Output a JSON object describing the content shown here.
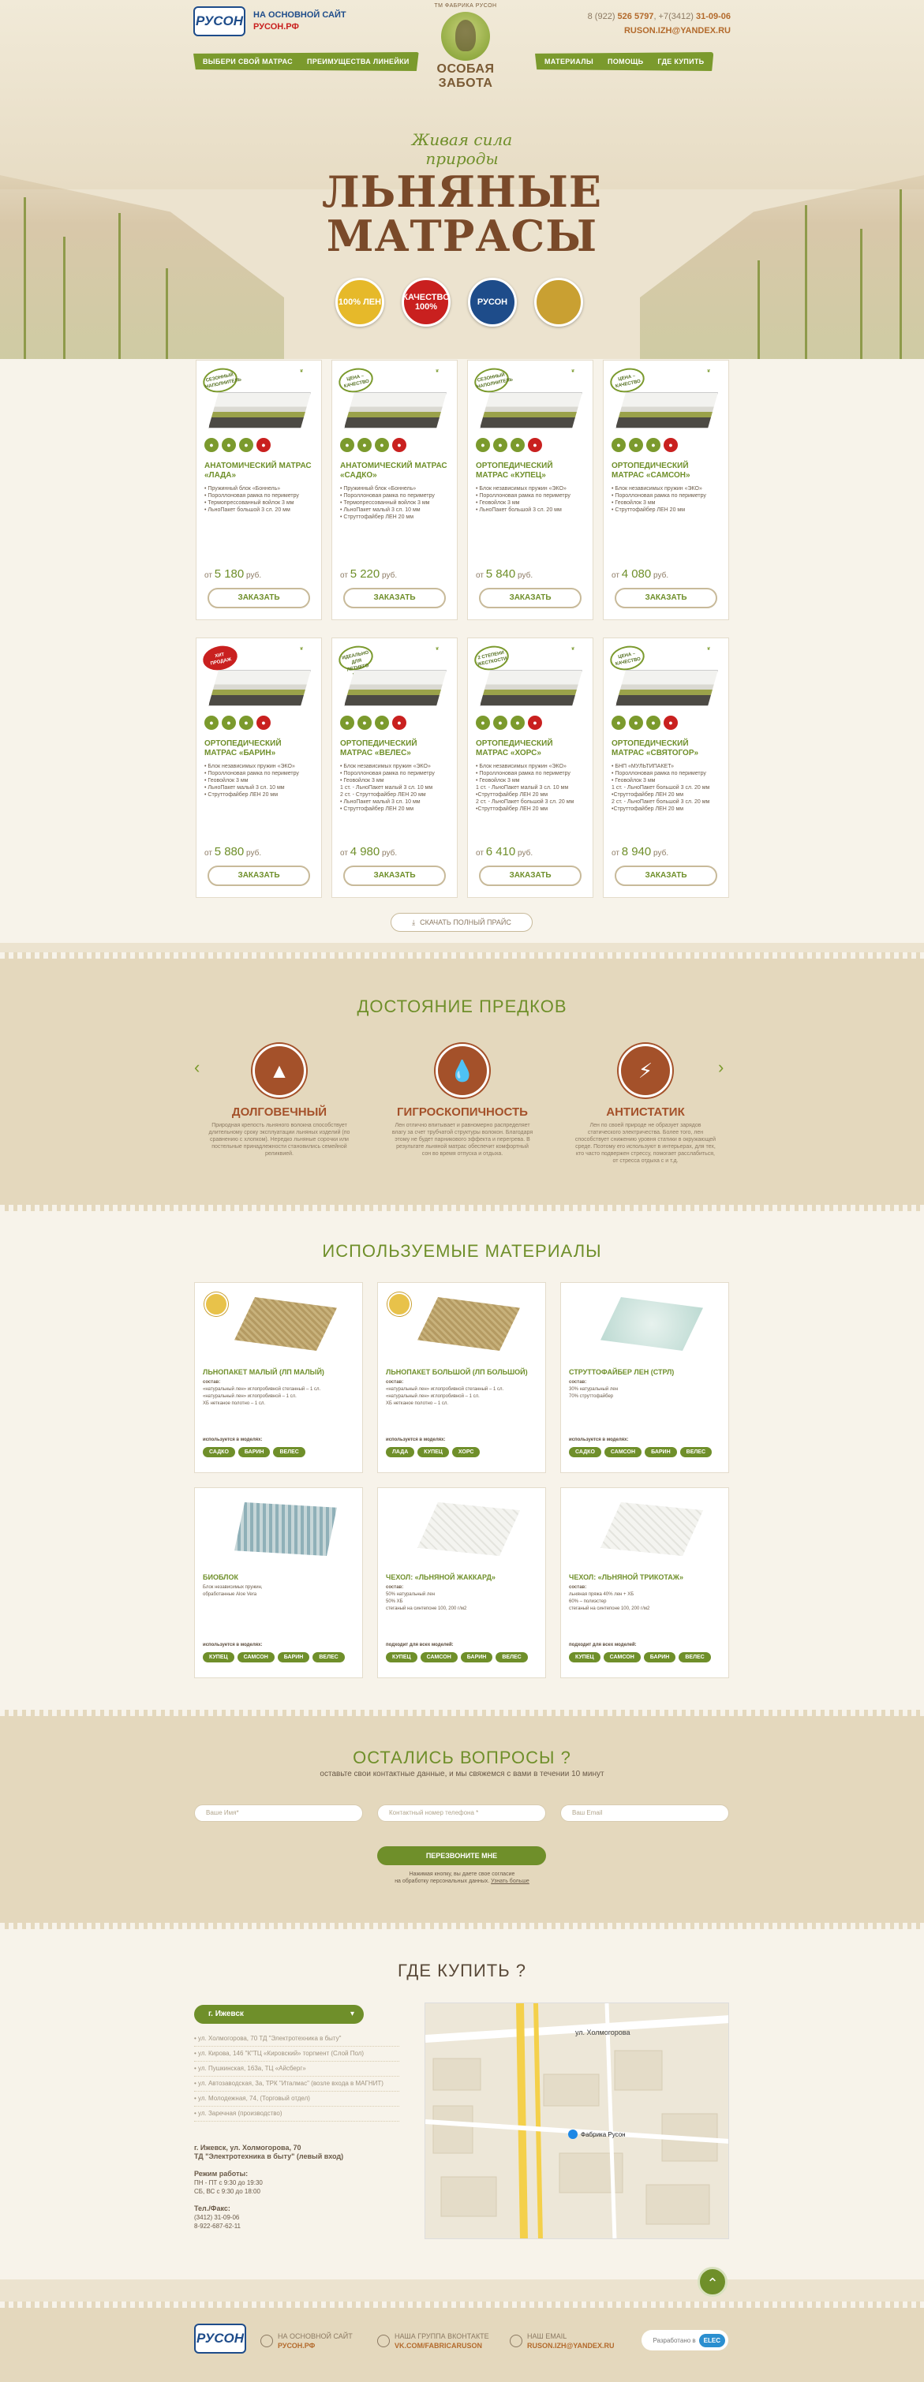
{
  "header": {
    "main_site_label": "НА ОСНОВНОЙ САЙТ",
    "main_site_url": "РУСОН.РФ",
    "logo_text": "РУСОН",
    "brand_arc": "ТМ ФАБРИКА РУСОН",
    "brand_name": "ОСОБАЯ ЗАБОТА",
    "phones_prefix": "8 (922)",
    "phone1": "526 5797",
    "phone_sep": ", +7(3412)",
    "phone2": "31-09-06",
    "email": "RUSON.IZH@YANDEX.RU",
    "nav_left": [
      "ВЫБЕРИ СВОЙ МАТРАС",
      "ПРЕИМУЩЕСТВА ЛИНЕЙКИ"
    ],
    "nav_right": [
      "МАТЕРИАЛЫ",
      "ПОМОЩЬ",
      "ГДЕ КУПИТЬ"
    ]
  },
  "hero": {
    "slogan_line1": "Живая сила",
    "slogan_line2": "природы",
    "title_line1": "ЛЬНЯНЫЕ",
    "title_line2": "МАТРАСЫ",
    "badges": [
      {
        "text": "100% ЛЕН",
        "color": "#e6b92a"
      },
      {
        "text": "КАЧЕСТВО 100%",
        "color": "#c9201f"
      },
      {
        "text": "РУСОН",
        "color": "#1e4c8a"
      },
      {
        "text": "",
        "color": "#c9a032"
      }
    ]
  },
  "products": [
    {
      "tag": "СЕЗОННЫЙ НАПОЛНИТЕЛЬ",
      "tag_red": false,
      "name": "АНАТОМИЧЕСКИЙ МАТРАС «ЛАДА»",
      "specs": [
        "• Пружинный блок «Боннель»",
        "• Пороллоновая рамка по периметру",
        "• Термопрессованный войлок 3 мм",
        "• ЛьноПакет большой 3 сл. 20 мм"
      ],
      "price": "5 180",
      "currency": "руб.",
      "price_prefix": "от",
      "order": "ЗАКАЗАТЬ"
    },
    {
      "tag": "ЦЕНА – КАЧЕСТВО",
      "tag_red": false,
      "name": "АНАТОМИЧЕСКИЙ МАТРАС «САДКО»",
      "specs": [
        "• Пружинный блок «Боннель»",
        "• Пороллоновая рамка по периметру",
        "• Термопрессованный войлок 3 мм",
        "• ЛьноПакет малый 3 сл. 10 мм",
        "• Струттофайбер ЛЕН 20 мм"
      ],
      "price": "5 220",
      "currency": "руб.",
      "price_prefix": "от",
      "order": "ЗАКАЗАТЬ"
    },
    {
      "tag": "СЕЗОННЫЙ НАПОЛНИТЕЛЬ",
      "tag_red": false,
      "name": "ОРТОПЕДИЧЕСКИЙ МАТРАС «КУПЕЦ»",
      "specs": [
        "• Блок независимых пружин «ЭКО»",
        "• Пороллоновая рамка по периметру",
        "• Геовойлок 3 мм",
        "• ЛьноПакет большой 3 сл. 20 мм"
      ],
      "price": "5 840",
      "currency": "руб.",
      "price_prefix": "от",
      "order": "ЗАКАЗАТЬ"
    },
    {
      "tag": "ЦЕНА – КАЧЕСТВО",
      "tag_red": false,
      "name": "ОРТОПЕДИЧЕСКИЙ МАТРАС «САМСОН»",
      "specs": [
        "• Блок независимых пружин «ЭКО»",
        "• Пороллоновая рамка по периметру",
        "• Геовойлок 3 мм",
        "• Струттофайбер ЛЕН 20 мм"
      ],
      "price": "4 080",
      "currency": "руб.",
      "price_prefix": "от",
      "order": "ЗАКАЗАТЬ"
    },
    {
      "tag": "ХИТ ПРОДАЖ",
      "tag_red": true,
      "name": "ОРТОПЕДИЧЕСКИЙ МАТРАС «БАРИН»",
      "specs": [
        "• Блок независимых пружин «ЭКО»",
        "• Пороллоновая рамка по периметру",
        "• Геовойлок 3 мм",
        "• ЛьноПакет малый 3 сл. 10 мм",
        "• Струттофайбер ЛЕН 20 мм"
      ],
      "price": "5 880",
      "currency": "руб.",
      "price_prefix": "от",
      "order": "ЗАКАЗАТЬ"
    },
    {
      "tag": "ИДЕАЛЬНО ДЛЯ ЛЕТНЕГО ВЕСА",
      "tag_red": false,
      "name": "ОРТОПЕДИЧЕСКИЙ МАТРАС «ВЕЛЕС»",
      "specs": [
        "• Блок независимых пружин «ЭКО»",
        "• Пороллоновая рамка по периметру",
        "• Геовойлок 3 мм",
        "1 ст. - ЛьноПакет малый 3 сл. 10 мм",
        "2 ст. - Струттофайбер ЛЕН 20 мм",
        "• ЛьноПакет малый 3 сл. 10 мм",
        "• Струттофайбер ЛЕН 20 мм"
      ],
      "price": "4 980",
      "currency": "руб.",
      "price_prefix": "от",
      "order": "ЗАКАЗАТЬ"
    },
    {
      "tag": "2 СТЕПЕНИ ЖЕСТКОСТИ",
      "tag_red": false,
      "name": "ОРТОПЕДИЧЕСКИЙ МАТРАС «ХОРС»",
      "specs": [
        "• Блок независимых пружин «ЭКО»",
        "• Пороллоновая рамка по периметру",
        "• Геовойлок 3 мм",
        "1 ст. - ЛьноПакет малый 3 сл. 10 мм",
        "  •Струттофайбер ЛЕН 20 мм",
        "2 ст. - ЛьноПакет большой 3 сл. 20 мм",
        "  •Струттофайбер ЛЕН 20 мм"
      ],
      "price": "6 410",
      "currency": "руб.",
      "price_prefix": "от",
      "order": "ЗАКАЗАТЬ"
    },
    {
      "tag": "ЦЕНА – КАЧЕСТВО",
      "tag_red": false,
      "name": "ОРТОПЕДИЧЕСКИЙ МАТРАС «СВЯТОГОР»",
      "specs": [
        "• БНП «МУЛЬТИПАКЕТ»",
        "• Пороллоновая рамка по периметру",
        "• Геовойлок 3 мм",
        "1 ст. - ЛьноПакет большой 3 сл. 20 мм",
        "  •Струттофайбер ЛЕН 20 мм",
        "2 ст. - ЛьноПакет большой 3 сл. 20 мм",
        "  •Струттофайбер ЛЕН 20 мм"
      ],
      "price": "8 940",
      "currency": "руб.",
      "price_prefix": "от",
      "order": "ЗАКАЗАТЬ"
    }
  ],
  "download_label": "СКАЧАТЬ ПОЛНЫЙ ПРАЙС",
  "legacy": {
    "title": "ДОСТОЯНИЕ ПРЕДКОВ",
    "features": [
      {
        "title": "ДОЛГОВЕЧНЫЙ",
        "text": "Природная крепость льняного волокна способствует длительному сроку эксплуатации льняных изделий (по сравнению с хлопком). Нередко льняные сорочки или постельные принадлежности становились семейной реликвией."
      },
      {
        "title": "ГИГРОСКОПИЧНОСТЬ",
        "text": "Лен отлично впитывает и равномерно распределяет влагу за счет трубчатой структуры волокон. Благодаря этому не будет парникового эффекта и перегрева. В результате льняной матрас обеспечит комфортный сон во время отпуска и отдыха."
      },
      {
        "title": "АНТИСТАТИК",
        "text": "Лен по своей природе не образует зарядов статического электричества. Более того, лен способствует снижению уровня статики в окружающей среде. Поэтому его используют в интерьерах, для тех, кто часто подвержен стрессу, помогает расслабиться, от стресса отдыха с и т.д."
      }
    ]
  },
  "materials": {
    "title": "ИСПОЛЬЗУЕМЫЕ МАТЕРИАЛЫ",
    "items": [
      {
        "name": "ЛЬНОПАКЕТ МАЛЫЙ (ЛП МАЛЫЙ)",
        "comp_label": "состав:",
        "comp": [
          "«натуральный лен» иглопробивной стеганный – 1 сл.",
          "«натуральный лен» иглопробивной – 1 сл.",
          "ХБ нетканое полотно – 1 сл."
        ],
        "used_label": "используется в моделях:",
        "models": [
          "САДКО",
          "БАРИН",
          "ВЕЛЕС"
        ],
        "seal": true,
        "img": "linen"
      },
      {
        "name": "ЛЬНОПАКЕТ БОЛЬШОЙ (ЛП БОЛЬШОЙ)",
        "comp_label": "состав:",
        "comp": [
          "«натуральный лен» иглопробивной стеганный – 1 сл.",
          "«натуральный лен» иглопробивной – 1 сл.",
          "ХБ нетканое полотно – 1 сл."
        ],
        "used_label": "используется в моделях:",
        "models": [
          "ЛАДА",
          "КУПЕЦ",
          "ХОРС"
        ],
        "seal": true,
        "img": "linen"
      },
      {
        "name": "СТРУТТОФАЙБЕР ЛЕН (СТРЛ)",
        "comp_label": "состав:",
        "comp": [
          "30% натуральный лен",
          "70% струттофайбер"
        ],
        "used_label": "используется в моделях:",
        "models": [
          "САДКО",
          "САМСОН",
          "БАРИН",
          "ВЕЛЕС"
        ],
        "seal": false,
        "img": "strutto"
      },
      {
        "name": "БИОБЛОК",
        "comp_label": "",
        "comp": [
          "Блок независимых пружин,",
          "обработанные Аloe Vera"
        ],
        "used_label": "используется в моделях:",
        "models": [
          "КУПЕЦ",
          "САМСОН",
          "БАРИН",
          "ВЕЛЕС"
        ],
        "seal": false,
        "img": "springs"
      },
      {
        "name": "ЧЕХОЛ: «ЛЬНЯНОЙ ЖАККАРД»",
        "comp_label": "состав:",
        "comp": [
          "50% натуральный лен",
          "50% ХБ",
          "стеганый на синтепоне 100, 200 г/м2"
        ],
        "used_label": "подходит для всех моделей:",
        "models": [
          "КУПЕЦ",
          "САМСОН",
          "БАРИН",
          "ВЕЛЕС"
        ],
        "seal": false,
        "img": "cover"
      },
      {
        "name": "ЧЕХОЛ: «ЛЬНЯНОЙ ТРИКОТАЖ»",
        "comp_label": "состав:",
        "comp": [
          "льняная пряжа 40% лен + ХБ",
          "60% – полиэстер",
          "стеганый на синтепоне 100, 200 г/м2"
        ],
        "used_label": "подходит для всех моделей:",
        "models": [
          "КУПЕЦ",
          "САМСОН",
          "БАРИН",
          "ВЕЛЕС"
        ],
        "seal": false,
        "img": "cover"
      }
    ]
  },
  "questions": {
    "title": "ОСТАЛИСЬ ВОПРОСЫ ?",
    "subtitle": "оставьте свои контактные данные, и мы свяжемся с вами в течении 10 минут",
    "name_placeholder": "Ваше Имя*",
    "phone_placeholder": "Контактный номер телефона *",
    "email_placeholder": "Ваш Email",
    "button": "ПЕРЕЗВОНИТЕ МНЕ",
    "note1": "Нажимая кнопку, вы даете свое согласие",
    "note2": "на обработку персональных данных.",
    "note_link": "Узнать больше"
  },
  "buy": {
    "title": "ГДЕ КУПИТЬ ?",
    "city": "г. Ижевск",
    "addresses": [
      "• ул. Холмогорова, 70 ТД \"Электротехника в быту\"",
      "• ул. Кирова, 146 \"К\"ТЦ «Кировский» торгмент (Слой Пол)",
      "• ул. Пушкинская, 163а, ТЦ «Айсберг»",
      "• ул. Автозаводская, 3а, ТРК \"Италмас\" (возле входа в МАГНИТ)",
      "• ул. Молодежная, 74, (Торговый отдел)",
      "• ул. Заречная (производство)"
    ],
    "shop_name": "г. Ижевск, ул. Холмогорова, 70",
    "shop_name2": "ТД \"Электротехника в быту\" (левый вход)",
    "hours_label": "Режим работы:",
    "hours1": "ПН - ПТ с 9:30 до 19:30",
    "hours2": "СБ, ВС с 9:30 до 18:00",
    "phones_label": "Тел./Факс:",
    "phone_a": "(3412) 31-09-06",
    "phone_b": "8-922-687-62-11",
    "map_street": "ул. Холмогорова",
    "map_marker": "Фабрика Русон"
  },
  "footer": {
    "main_site": "НА ОСНОВНОЙ САЙТ",
    "main_url": "РУСОН.РФ",
    "vk_label": "НАША ГРУППА ВКОНТАКТЕ",
    "vk_url": "VK.COM/FABRICARUSON",
    "mail_label": "НАШ EMAIL",
    "mail_value": "RUSON.IZH@YANDEX.RU",
    "dev_label": "Разработано в",
    "dev_logo": "ELEC"
  }
}
